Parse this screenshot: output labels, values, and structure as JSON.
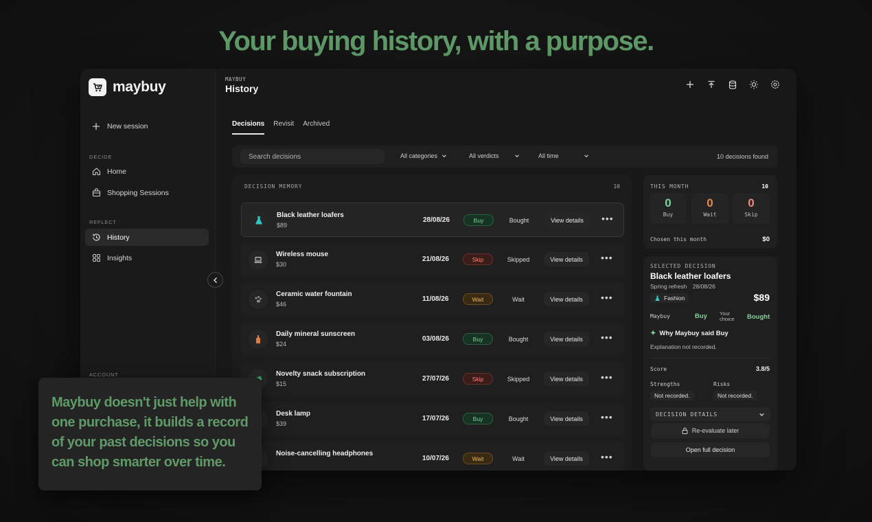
{
  "headline": "Your buying history, with a purpose.",
  "sidebar": {
    "brand": "maybuy",
    "new_session": "New session",
    "section_decide": "DECIDE",
    "section_reflect": "REFLECT",
    "section_account": "ACCOUNT",
    "items": {
      "home": "Home",
      "shopping_sessions": "Shopping Sessions",
      "history": "History",
      "insights": "Insights"
    }
  },
  "header": {
    "breadcrumb": "MAYBUY",
    "title": "History"
  },
  "tabs": [
    "Decisions",
    "Revisit",
    "Archived"
  ],
  "filters": {
    "search_placeholder": "Search decisions",
    "categories": "All categories",
    "verdicts": "All verdicts",
    "time": "All time",
    "found": "10 decisions found"
  },
  "memory": {
    "label": "DECISION MEMORY",
    "count": "10",
    "view_label": "View details",
    "more_label": "•••",
    "rows": [
      {
        "name": "Black leather loafers",
        "price": "$89",
        "date": "28/08/26",
        "verdict": "Buy",
        "status": "Bought",
        "icon": "dress-icon",
        "icon_color": "#2fc7c4"
      },
      {
        "name": "Wireless mouse",
        "price": "$30",
        "date": "21/08/26",
        "verdict": "Skip",
        "status": "Skipped",
        "icon": "laptop-icon",
        "icon_color": "#e0e0e0"
      },
      {
        "name": "Ceramic water fountain",
        "price": "$46",
        "date": "11/08/26",
        "verdict": "Wait",
        "status": "Wait",
        "icon": "paw-icon",
        "icon_color": "#9a9a9a"
      },
      {
        "name": "Daily mineral sunscreen",
        "price": "$24",
        "date": "03/08/26",
        "verdict": "Buy",
        "status": "Bought",
        "icon": "bottle-icon",
        "icon_color": "#e07a45"
      },
      {
        "name": "Novelty snack subscription",
        "price": "$15",
        "date": "27/07/26",
        "verdict": "Skip",
        "status": "Skipped",
        "icon": "money-icon",
        "icon_color": "#3aa66a"
      },
      {
        "name": "Desk lamp",
        "price": "$39",
        "date": "17/07/26",
        "verdict": "Buy",
        "status": "Bought",
        "icon": "lamp-icon",
        "icon_color": "#bdbdbd"
      },
      {
        "name": "Noise-cancelling headphones",
        "price": "",
        "date": "10/07/26",
        "verdict": "Wait",
        "status": "Wait",
        "icon": "headphones-icon",
        "icon_color": "#bdbdbd"
      }
    ]
  },
  "this_month": {
    "label": "THIS MONTH",
    "count": "10",
    "buy_value": "0",
    "buy_label": "Buy",
    "wait_value": "0",
    "wait_label": "Wait",
    "skip_value": "0",
    "skip_label": "Skip",
    "chosen_label": "Chosen this month",
    "chosen_value": "$0"
  },
  "selected": {
    "label": "SELECTED DECISION",
    "name": "Black leather loafers",
    "session": "Spring refresh",
    "date": "28/08/26",
    "category": "Fashion",
    "price": "$89",
    "maybuy_label": "Maybuy",
    "maybuy_verdict": "Buy",
    "your_choice_label": "Your choice",
    "your_choice": "Bought",
    "why_label": "Why Maybuy said Buy",
    "explanation": "Explanation not recorded.",
    "score_label": "Score",
    "score_value": "3.8/5",
    "strengths_label": "Strengths",
    "strengths_value": "Not recorded.",
    "risks_label": "Risks",
    "risks_value": "Not recorded.",
    "details_label": "DECISION DETAILS",
    "reevaluate": "Re-evaluate later",
    "open_full": "Open full decision"
  },
  "overlay_text": "Maybuy doesn't just help with one purchase, it builds a record of your past decisions so you can shop smarter over time.",
  "colors": {
    "accent_green": "#5f9a68",
    "buy": "#7fd59a",
    "skip": "#f08a80",
    "wait": "#e7b865"
  }
}
